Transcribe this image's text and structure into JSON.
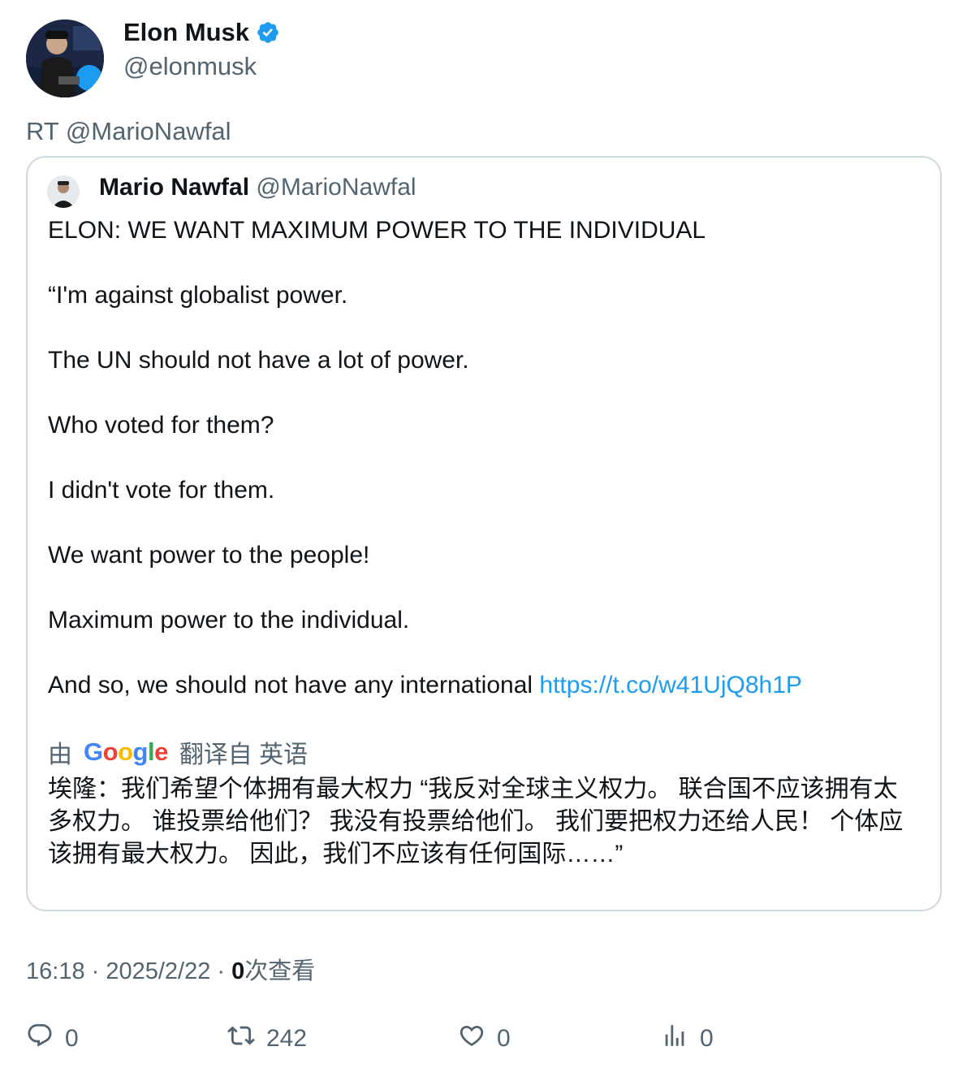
{
  "author": {
    "name": "Elon Musk",
    "handle": "@elonmusk",
    "verified_icon": "verified-badge-icon",
    "accent_color": "#1d9bf0"
  },
  "retweet_text": "RT @MarioNawfal",
  "quoted": {
    "name": "Mario Nawfal",
    "handle": "@MarioNawfal",
    "paragraphs": [
      "ELON: WE WANT MAXIMUM POWER TO THE INDIVIDUAL",
      "“I'm against globalist power.",
      "The UN should not have a lot of power.",
      "Who voted for them?",
      "I didn't vote for them.",
      "We want power to the people!",
      "Maximum power to the individual."
    ],
    "last_text": "And so, we should not have any international ",
    "link": "https://t.co/w41UjQ8h1P",
    "translate_prefix": "由",
    "translate_brand": "Google",
    "translate_suffix": "翻译自 英语",
    "translation": "埃隆：我们希望个体拥有最大权力 “我反对全球主义权力。 联合国不应该拥有太多权力。 谁投票给他们？ 我没有投票给他们。 我们要把权力还给人民！ 个体应该拥有最大权力。 因此，我们不应该有任何国际……”"
  },
  "meta": {
    "time": "16:18",
    "separator": " · ",
    "date": "2025/2/22",
    "views_count": "0",
    "views_label": "次查看"
  },
  "actions": {
    "reply_count": "0",
    "retweet_count": "242",
    "like_count": "0",
    "views_count": "0"
  }
}
